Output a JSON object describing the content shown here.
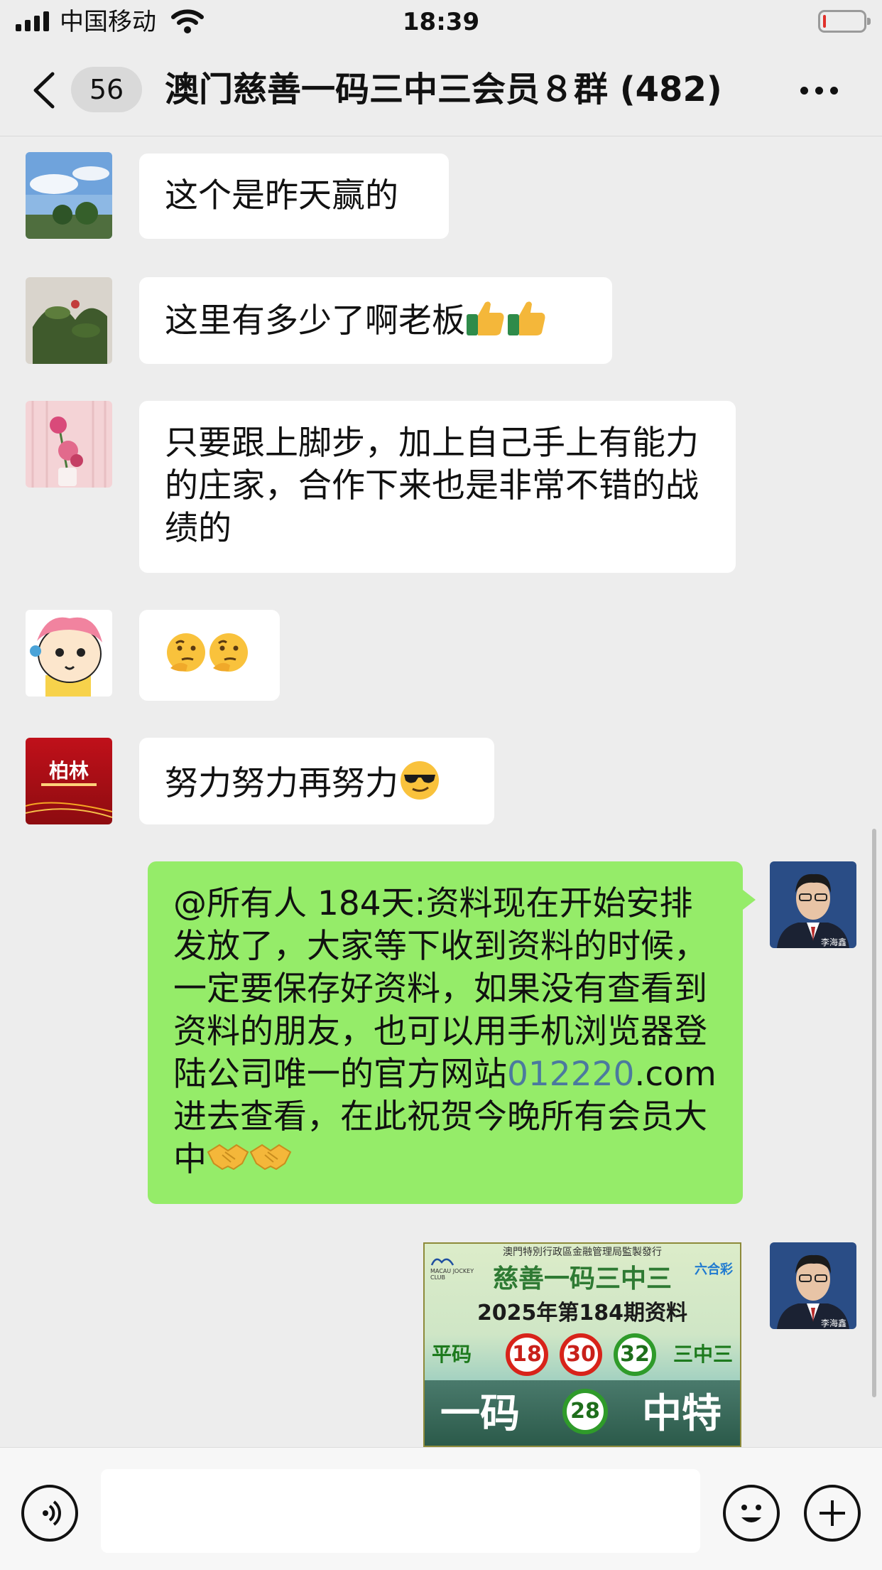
{
  "status_bar": {
    "carrier": "中国移动",
    "time": "18:39"
  },
  "nav": {
    "unread_count": "56",
    "title": "澳门慈善一码三中三会员８群 (482)"
  },
  "messages": [
    {
      "text": "这个是昨天赢的"
    },
    {
      "text": "这里有多少了啊老板",
      "emojis": "thumbs-up thumbs-up"
    },
    {
      "text": "只要跟上脚步，加上自己手上有能力的庄家，合作下来也是非常不错的战绩的"
    },
    {
      "emojis": "thinking-face thinking-face"
    },
    {
      "text": "努力努力再努力",
      "emojis": "sunglasses-face"
    },
    {
      "text_before_link": "@所有人 184天:资料现在开始安排发放了，大家等下收到资料的时候，一定要保存好资料，如果没有查看到资料的朋友，也可以用手机浏览器登陆公司唯一的官方网站",
      "link": "012220",
      "text_after_link": ".com进去查看，在此祝贺今晚所有会员大中",
      "emojis": "handshake handshake"
    }
  ],
  "avatars": {
    "pill_text": "柏林",
    "sender_caption": "李海鑫"
  },
  "image_card": {
    "top_line": "澳門特別行政區金融管理局監製發行",
    "club": "MACAU JOCKEY CLUB",
    "badge": "六合彩",
    "title": "慈善一码三中三",
    "issue": "2025年第184期资料",
    "label_left": "平码",
    "balls": [
      "18",
      "30",
      "32"
    ],
    "label_right": "三中三",
    "bottom_left": "一码",
    "bottom_ball": "28",
    "bottom_right": "中特"
  },
  "colors": {
    "outgoing_bubble": "#95ec69",
    "incoming_bubble": "#ffffff",
    "background": "#ededed",
    "link": "#4b7a9e"
  }
}
